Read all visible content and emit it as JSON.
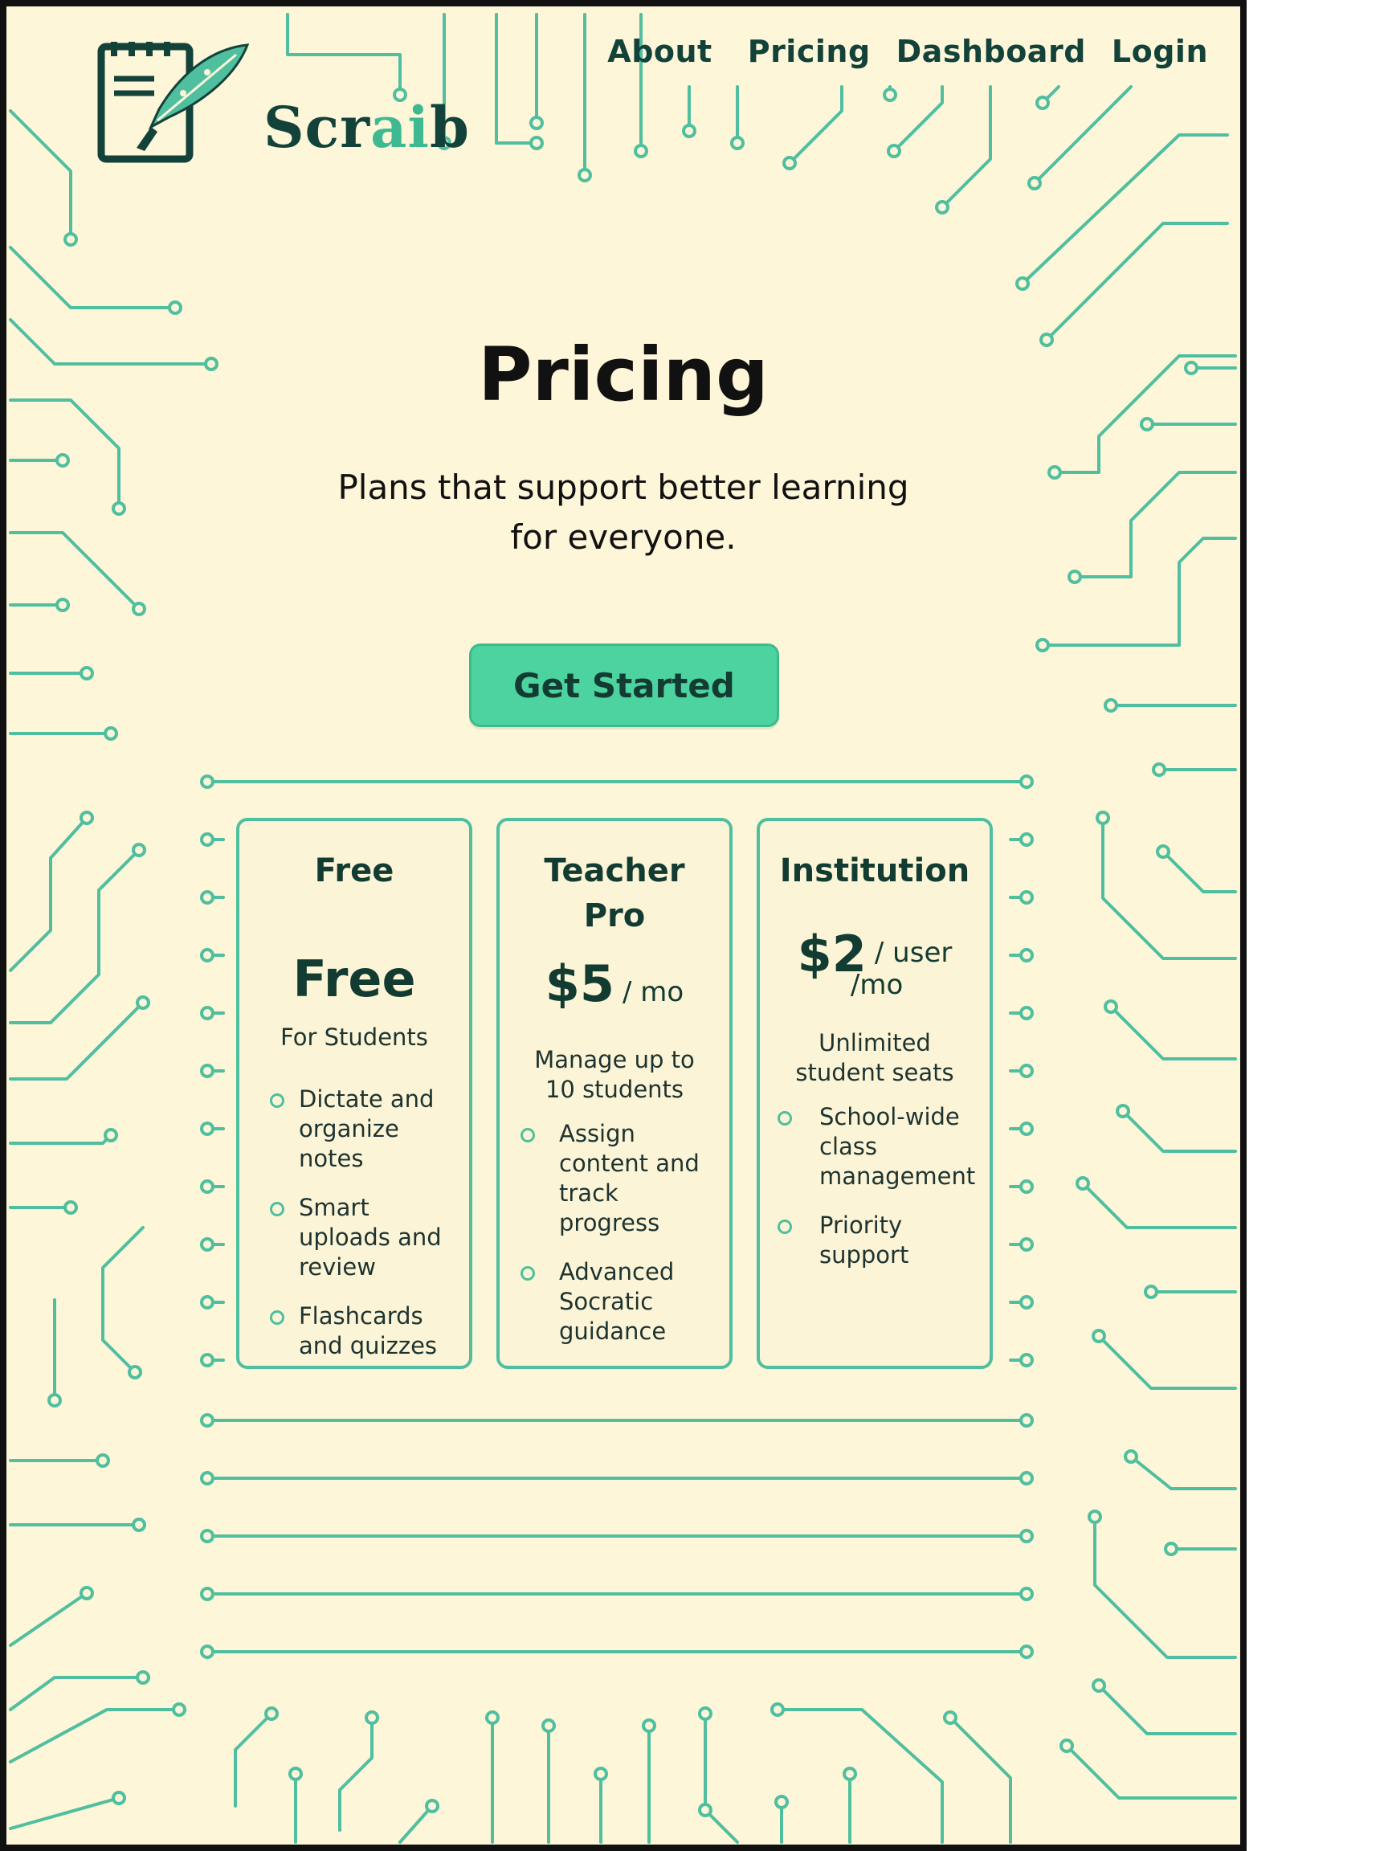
{
  "brand": {
    "name_start": "Scr",
    "name_accent": "ai",
    "name_end": "b",
    "logo_icon": "notepad-quill-icon"
  },
  "nav": {
    "items": [
      "About",
      "Pricing",
      "Dashboard",
      "Login"
    ]
  },
  "hero": {
    "title": "Pricing",
    "subtitle_line1": "Plans that support better learning",
    "subtitle_line2": "for everyone.",
    "cta_label": "Get Started"
  },
  "plans": [
    {
      "title": "Free",
      "price": "Free",
      "unit": "",
      "tagline": "For Students",
      "features": [
        "Dictate and organize notes",
        "Smart uploads and review",
        "Flashcards and quizzes"
      ]
    },
    {
      "title_line1": "Teacher",
      "title_line2": "Pro",
      "price": "$5",
      "unit": "/ mo",
      "tagline_line1": "Manage up to",
      "tagline_line2": "10 students",
      "features": [
        "Assign content and track progress",
        "Advanced Socratic guidance"
      ]
    },
    {
      "title": "Institution",
      "price": "$2",
      "unit_line1": "/ user",
      "unit_line2": "/mo",
      "tagline_line1": "Unlimited",
      "tagline_line2": "student seats",
      "features": [
        "School-wide class management",
        "Priority support"
      ]
    }
  ],
  "colors": {
    "background": "#fdf6d8",
    "circuit": "#4fbf9f",
    "dark_text": "#12423a",
    "cta": "#4dd39f",
    "border": "#111111"
  },
  "decoration": {
    "pattern": "circuit-board-traces"
  }
}
